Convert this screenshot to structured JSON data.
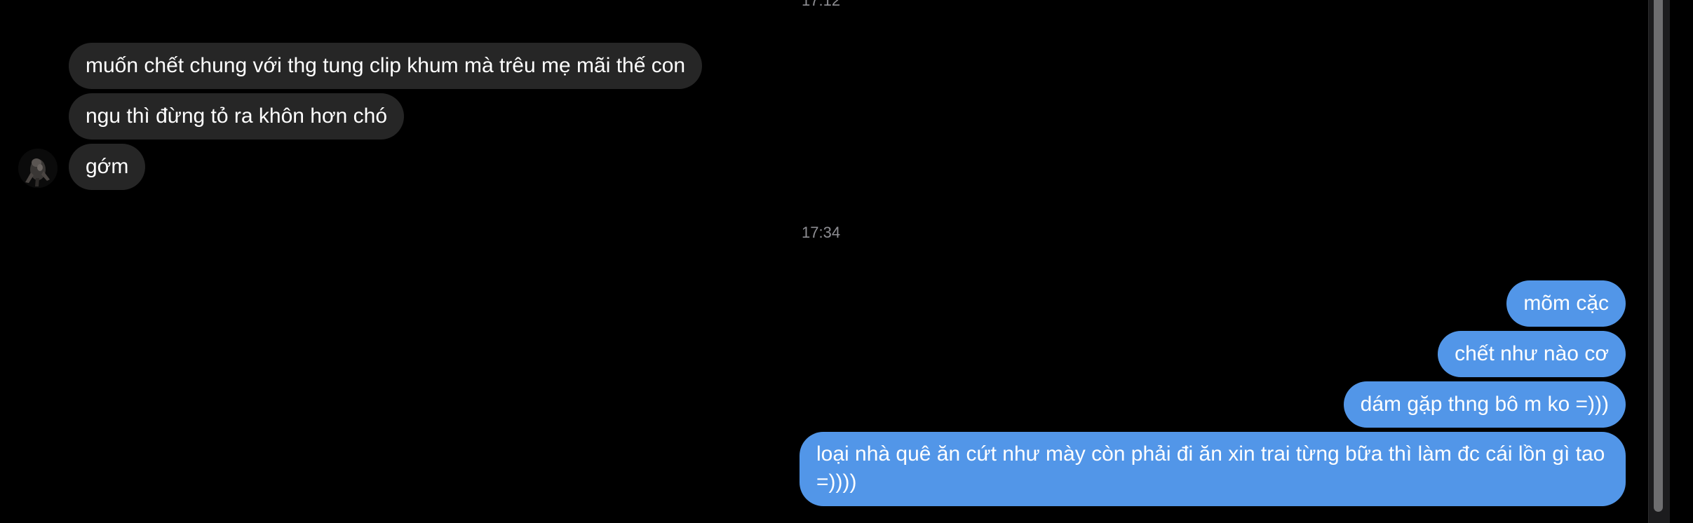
{
  "conversation": {
    "timestamps": {
      "previous": "17:12",
      "divider": "17:34"
    },
    "incoming_messages": [
      "muốn chết chung với thg tung clip khum mà trêu mẹ mãi thế con",
      "ngu thì đừng tỏ ra khôn hơn chó",
      "gớm"
    ],
    "outgoing_messages": [
      "mõm cặc",
      "chết như nào cơ",
      "dám gặp thng bô m ko =)))",
      "loại nhà quê ăn cứt như mày còn phải đi ăn xin trai từng bữa thì làm đc cái lồn gì tao =))))"
    ]
  },
  "colors": {
    "background": "#000000",
    "incoming_bubble": "#262626",
    "outgoing_bubble": "#5296e8",
    "timestamp_text": "#8e8e93"
  },
  "icons": {
    "avatar": "contact-avatar"
  }
}
